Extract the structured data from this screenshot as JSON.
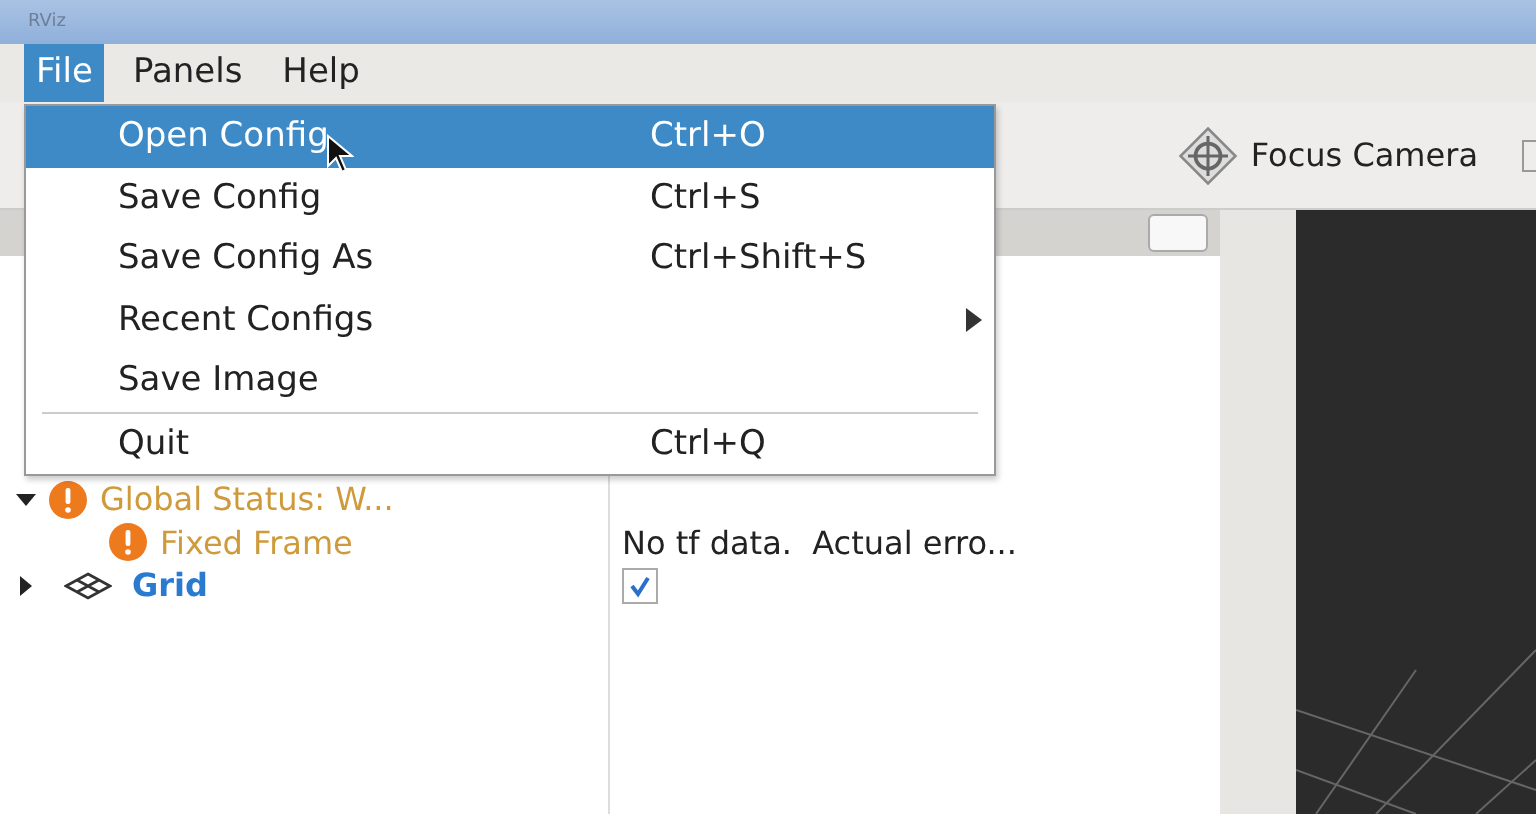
{
  "window": {
    "title": "RViz"
  },
  "menubar": [
    {
      "label": "File",
      "selected": true
    },
    {
      "label": "Panels",
      "selected": false
    },
    {
      "label": "Help",
      "selected": false
    }
  ],
  "file_menu": {
    "items": [
      {
        "kind": "item",
        "label": "Open Config",
        "shortcut": "Ctrl+O",
        "selected": true
      },
      {
        "kind": "item",
        "label": "Save Config",
        "shortcut": "Ctrl+S",
        "selected": false
      },
      {
        "kind": "item",
        "label": "Save Config As",
        "shortcut": "Ctrl+Shift+S",
        "selected": false
      },
      {
        "kind": "submenu",
        "label": "Recent Configs",
        "selected": false
      },
      {
        "kind": "item",
        "label": "Save Image",
        "selected": false
      },
      {
        "kind": "separator"
      },
      {
        "kind": "item",
        "label": "Quit",
        "shortcut": "Ctrl+Q",
        "selected": false
      }
    ]
  },
  "toolbar": {
    "buttons": [
      {
        "label": "Focus Camera"
      }
    ]
  },
  "displays": {
    "tree": [
      {
        "label": "Global Status: W...",
        "warning": true,
        "expanded": true,
        "children": [
          {
            "label": "Fixed Frame",
            "warning": true,
            "value": "No tf data.  Actual erro..."
          }
        ]
      },
      {
        "label": "Grid",
        "warning": false,
        "kind": "grid",
        "expanded": false,
        "checked": true
      }
    ]
  }
}
